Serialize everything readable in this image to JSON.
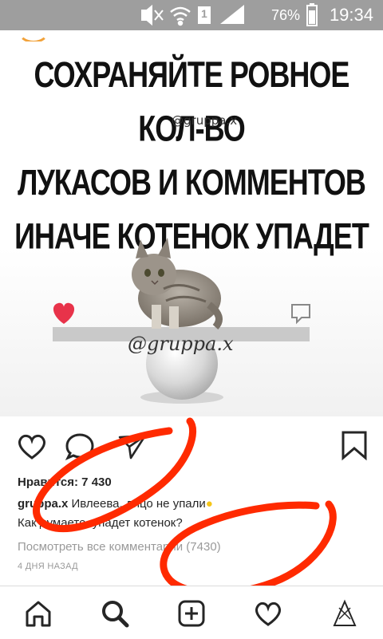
{
  "status_bar": {
    "battery_percent": "76%",
    "time": "19:34",
    "sim_slot": "1"
  },
  "post": {
    "image_caption_lines": [
      "СОХРАНЯЙТЕ РОВНОЕ КОЛ-ВО",
      "ЛУКАСОВ И КОММЕНТОВ",
      "ИНАЧЕ КОТЕНОК УПАДЕТ"
    ],
    "watermark_small": "@gruppa.x",
    "watermark_large": "@gruppa.x",
    "likes_text": "Нравится: 7 430",
    "caption_user": "gruppa.x",
    "caption_text": " Ивлеева, лицо не упали",
    "caption_line2": "Как думаете, упадет котенок?",
    "view_comments": "Посмотреть все комментарии (7430)",
    "time_ago": "4 ДНЯ НАЗАД"
  },
  "colors": {
    "status_bar_bg": "#9e9e9e",
    "scribble_red": "#ff2a00",
    "heart_red": "#e8334a",
    "text_dark": "#262626",
    "text_muted": "#9a9a9a"
  },
  "icons": {
    "actions": [
      "heart-icon",
      "comment-icon",
      "share-icon",
      "bookmark-icon"
    ],
    "nav": [
      "home-icon",
      "search-icon",
      "add-post-icon",
      "activity-heart-icon",
      "profile-icon"
    ]
  }
}
